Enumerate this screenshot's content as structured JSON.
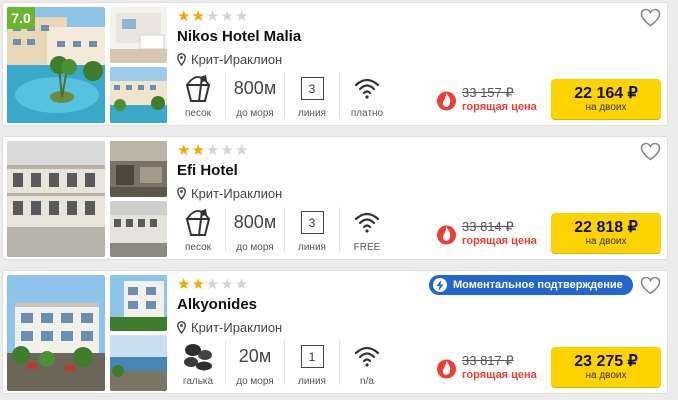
{
  "hotels": [
    {
      "rating": "7.0",
      "stars_on": 2,
      "stars_total": 5,
      "name": "Nikos Hotel Malia",
      "location": "Крит-Ираклион",
      "beach_type_icon": "bucket-icon",
      "beach_type": "песок",
      "distance": "800м",
      "distance_label": "до моря",
      "line": "3",
      "line_label": "линия",
      "wifi_label": "платно",
      "old_price": "33 157 ₽",
      "hot_label": "горящая цена",
      "price": "22 164 ₽",
      "price_note": "на двоих"
    },
    {
      "stars_on": 2,
      "stars_total": 5,
      "name": "Efi Hotel",
      "location": "Крит-Ираклион",
      "beach_type_icon": "bucket-icon",
      "beach_type": "песок",
      "distance": "800м",
      "distance_label": "до моря",
      "line": "3",
      "line_label": "линия",
      "wifi_label": "FREE",
      "old_price": "33 814 ₽",
      "hot_label": "горящая цена",
      "price": "22 818 ₽",
      "price_note": "на двоих"
    },
    {
      "stars_on": 2,
      "stars_total": 5,
      "name": "Alkyonides",
      "location": "Крит-Ираклион",
      "instant_badge": "Моментальное подтверждение",
      "beach_type_icon": "pebbles-icon",
      "beach_type": "галька",
      "distance": "20м",
      "distance_label": "до моря",
      "line": "1",
      "line_label": "линия",
      "wifi_label": "n/a",
      "old_price": "33 817 ₽",
      "hot_label": "горящая цена",
      "price": "23 275 ₽",
      "price_note": "на двоих"
    }
  ],
  "colors": {
    "star_on": "#f3a700",
    "star_off": "#d4d4d4",
    "rating_badge": "#6cb52e",
    "hot_price": "#ef3d33",
    "price_button": "#ffd300",
    "instant_badge": "#2466d0"
  }
}
